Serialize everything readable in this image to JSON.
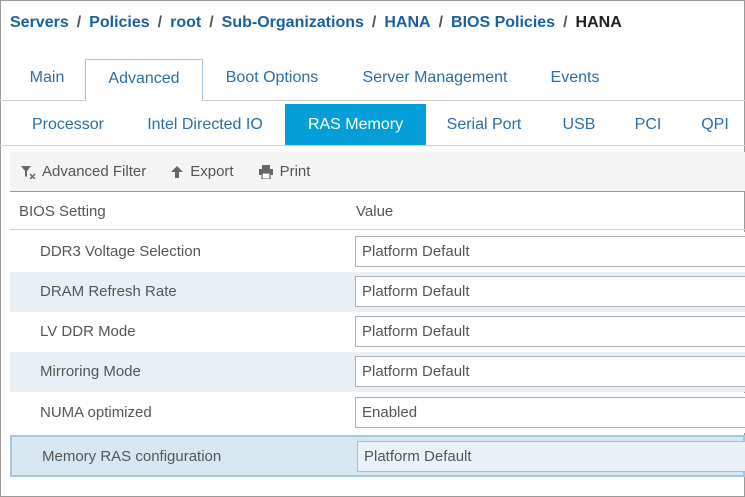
{
  "breadcrumb": {
    "items": [
      "Servers",
      "Policies",
      "root",
      "Sub-Organizations",
      "HANA",
      "BIOS Policies"
    ],
    "current": "HANA",
    "separator": "/"
  },
  "main_tabs": [
    "Main",
    "Advanced",
    "Boot Options",
    "Server Management",
    "Events"
  ],
  "main_tabs_active": "Advanced",
  "sub_tabs": [
    "Processor",
    "Intel Directed IO",
    "RAS Memory",
    "Serial Port",
    "USB",
    "PCI",
    "QPI"
  ],
  "sub_tabs_active": "RAS Memory",
  "toolbar": {
    "filter_label": "Advanced Filter",
    "export_label": "Export",
    "print_label": "Print"
  },
  "table": {
    "headers": [
      "BIOS Setting",
      "Value"
    ],
    "rows": [
      {
        "setting": "DDR3 Voltage Selection",
        "value": "Platform Default"
      },
      {
        "setting": "DRAM Refresh Rate",
        "value": "Platform Default"
      },
      {
        "setting": "LV DDR Mode",
        "value": "Platform Default"
      },
      {
        "setting": "Mirroring Mode",
        "value": "Platform Default"
      },
      {
        "setting": "NUMA optimized",
        "value": "Enabled"
      },
      {
        "setting": "Memory RAS configuration",
        "value": "Platform Default"
      }
    ],
    "selected_row": 5
  },
  "colors": {
    "link": "#1a5f9e",
    "tab_text": "#2a6ea8",
    "active_subtab_bg": "#049fd9",
    "alt_row_bg": "#e9f0f5",
    "selected_row_bg": "#d7e7f1"
  },
  "icons": {
    "filter": "filter-icon",
    "export": "arrow-up-icon",
    "print": "printer-icon"
  }
}
